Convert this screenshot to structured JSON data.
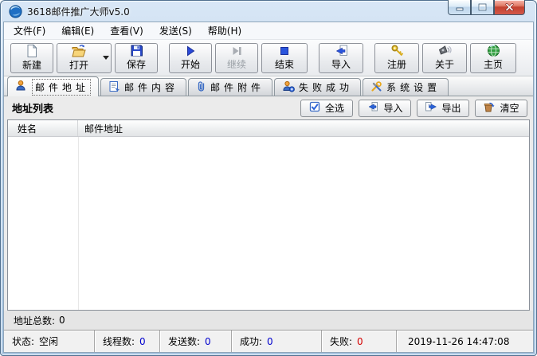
{
  "window": {
    "title": "3618邮件推广大师v5.0",
    "app_icon": "blue-globe-swirl-icon",
    "controls": {
      "minimize": "minimize",
      "maximize": "maximize",
      "close": "close"
    }
  },
  "menu": {
    "items": [
      "文件(F)",
      "编辑(E)",
      "查看(V)",
      "发送(S)",
      "帮助(H)"
    ]
  },
  "toolbar": {
    "buttons": [
      {
        "label": "新建",
        "icon": "new-document-icon",
        "enabled": true
      },
      {
        "label": "打开",
        "icon": "open-folder-icon",
        "enabled": true,
        "has_dropdown": true
      },
      {
        "label": "保存",
        "icon": "save-floppy-icon",
        "enabled": true
      },
      {
        "label": "开始",
        "icon": "start-play-icon",
        "enabled": true
      },
      {
        "label": "继续",
        "icon": "continue-play-pause-icon",
        "enabled": false
      },
      {
        "label": "结束",
        "icon": "stop-square-icon",
        "enabled": true
      },
      {
        "label": "导入",
        "icon": "import-page-arrow-icon",
        "enabled": true
      },
      {
        "label": "注册",
        "icon": "register-key-icon",
        "enabled": true
      },
      {
        "label": "关于",
        "icon": "about-megaphone-icon",
        "enabled": true
      },
      {
        "label": "主页",
        "icon": "home-globe-icon",
        "enabled": true
      }
    ]
  },
  "tabs": [
    {
      "label": "邮件地址",
      "icon": "address-person-icon",
      "active": true
    },
    {
      "label": "邮件内容",
      "icon": "mail-content-page-icon",
      "active": false
    },
    {
      "label": "邮件附件",
      "icon": "attachment-paperclip-icon",
      "active": false
    },
    {
      "label": "失败成功",
      "icon": "person-add-icon",
      "active": false
    },
    {
      "label": "系统设置",
      "icon": "tools-settings-icon",
      "active": false
    }
  ],
  "panel": {
    "title": "地址列表",
    "buttons": [
      {
        "label": "全选",
        "icon": "select-all-checkbox-icon"
      },
      {
        "label": "导入",
        "icon": "import-arrow-left-icon"
      },
      {
        "label": "导出",
        "icon": "export-arrow-right-icon"
      },
      {
        "label": "清空",
        "icon": "clear-trash-icon"
      }
    ]
  },
  "table": {
    "columns": [
      "姓名",
      "邮件地址"
    ],
    "rows": []
  },
  "address_total": {
    "label": "地址总数:",
    "value": "0"
  },
  "statusbar": {
    "status": {
      "label": "状态:",
      "value": "空闲"
    },
    "threads": {
      "label": "线程数:",
      "value": "0"
    },
    "sent": {
      "label": "发送数:",
      "value": "0"
    },
    "success": {
      "label": "成功:",
      "value": "0"
    },
    "failed": {
      "label": "失败:",
      "value": "0"
    },
    "datetime": "2019-11-26 14:47:08"
  },
  "colors": {
    "titlebar_blue": "#b9d2ea",
    "value_blue": "#0000cd",
    "value_red": "#d40000",
    "close_button_red": "#c3412f",
    "accent_icon_blue": "#2a55cc"
  }
}
